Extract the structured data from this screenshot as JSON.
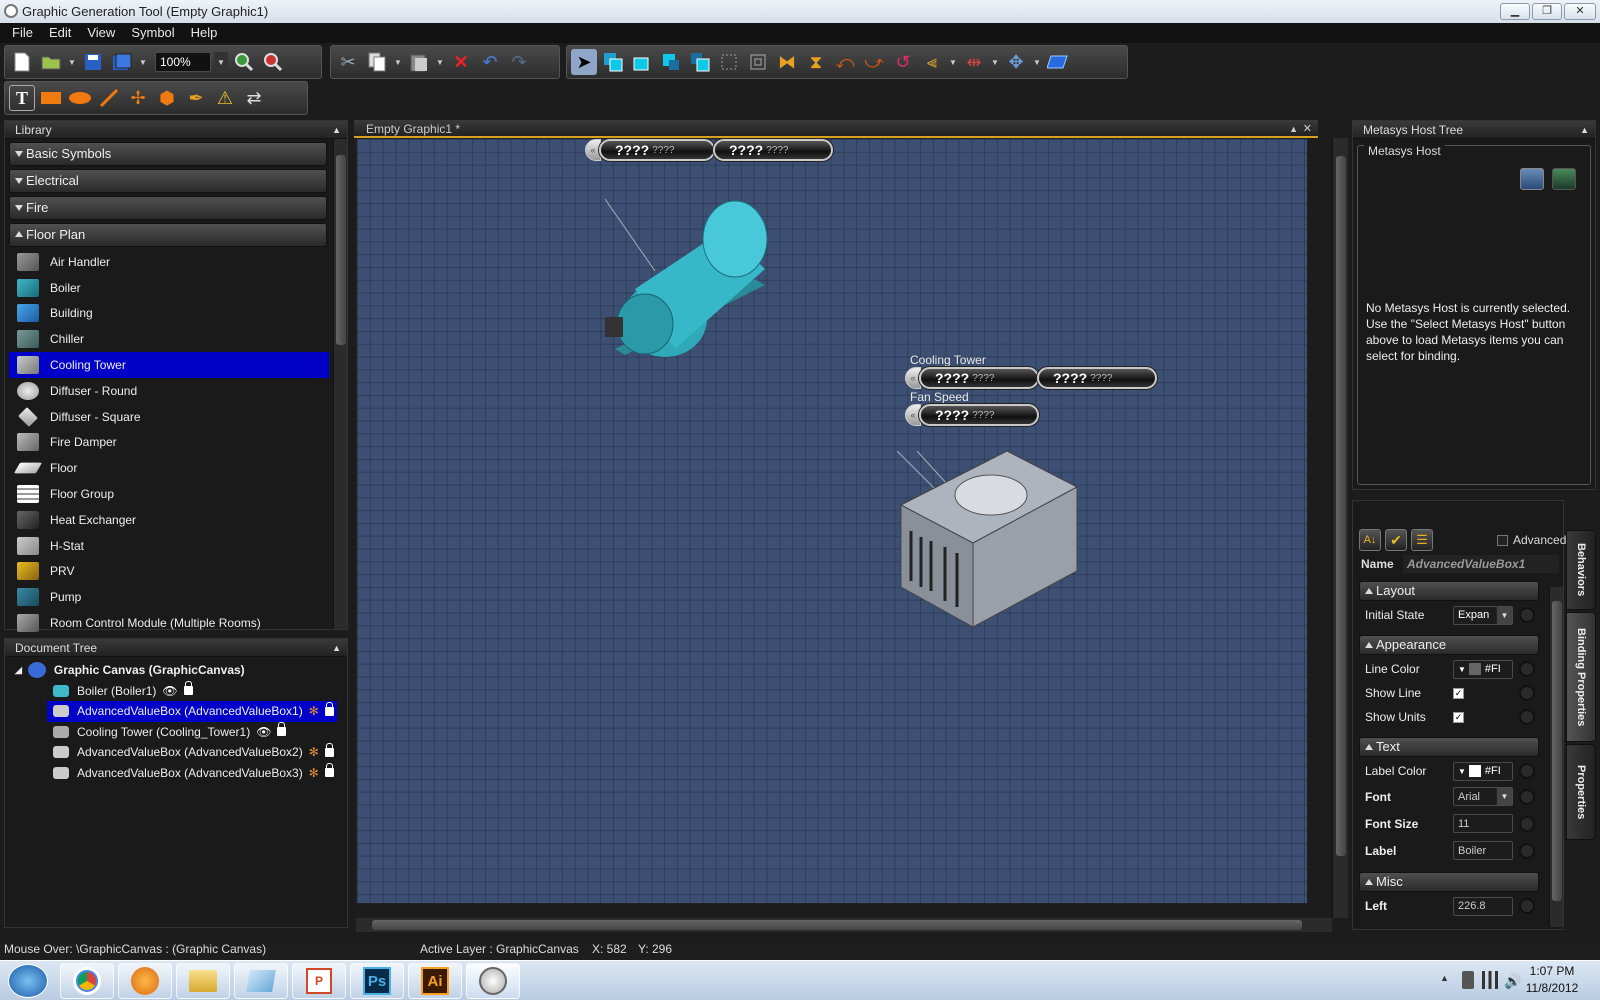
{
  "window": {
    "title": "Graphic Generation Tool (Empty Graphic1)",
    "min_glyph": "▁",
    "max_glyph": "❐",
    "close_glyph": "✕"
  },
  "menu": [
    "File",
    "Edit",
    "View",
    "Symbol",
    "Help"
  ],
  "toolbar": {
    "zoom": "100%"
  },
  "library": {
    "header": "Library",
    "categories": [
      "Basic Symbols",
      "Electrical",
      "Fire",
      "Floor Plan"
    ],
    "items": [
      "Air Handler",
      "Boiler",
      "Building",
      "Chiller",
      "Cooling Tower",
      "Diffuser - Round",
      "Diffuser - Square",
      "Fire Damper",
      "Floor",
      "Floor Group",
      "Heat Exchanger",
      "H-Stat",
      "PRV",
      "Pump",
      "Room Control Module (Multiple Rooms)"
    ]
  },
  "document_tree": {
    "header": "Document Tree",
    "root": "Graphic Canvas (GraphicCanvas)",
    "items": [
      "Boiler (Boiler1)",
      "AdvancedValueBox (AdvancedValueBox1)",
      "Cooling Tower (Cooling_Tower1)",
      "AdvancedValueBox (AdvancedValueBox2)",
      "AdvancedValueBox (AdvancedValueBox3)"
    ]
  },
  "canvas": {
    "tab": "Empty Graphic1 *",
    "value_placeholder": "????",
    "value_units": "????",
    "label_cooling_tower": "Cooling Tower",
    "label_fan_speed": "Fan Speed"
  },
  "host_tree": {
    "header": "Metasys Host Tree",
    "group": "Metasys Host",
    "msg_line1": "No Metasys Host is currently selected.",
    "msg_line2": "Use the \"Select Metasys Host\" button above to load Metasys items you can select for binding."
  },
  "properties": {
    "advanced_label": "Advanced",
    "name_label": "Name",
    "name_value": "AdvancedValueBox1",
    "sections": {
      "layout": "Layout",
      "appearance": "Appearance",
      "text": "Text",
      "misc": "Misc"
    },
    "initial_state_label": "Initial State",
    "initial_state_value": "Expan",
    "line_color_label": "Line Color",
    "line_color_value": "#FI",
    "show_line_label": "Show Line",
    "show_units_label": "Show Units",
    "label_color_label": "Label Color",
    "label_color_value": "#FI",
    "font_label": "Font",
    "font_value": "Arial",
    "font_size_label": "Font Size",
    "font_size_value": "11",
    "label_label": "Label",
    "label_value": "Boiler",
    "left_label": "Left",
    "left_value": "226.8",
    "tabs": [
      "Behaviors",
      "Binding Properties",
      "Properties"
    ]
  },
  "status": {
    "mouse_over": "Mouse Over: \\GraphicCanvas : (Graphic Canvas)",
    "layer": "Active Layer : GraphicCanvas",
    "x": "X: 582",
    "y": "Y: 296"
  },
  "taskbar": {
    "time": "1:07 PM",
    "date": "11/8/2012",
    "ps": "Ps",
    "ai": "Ai"
  }
}
